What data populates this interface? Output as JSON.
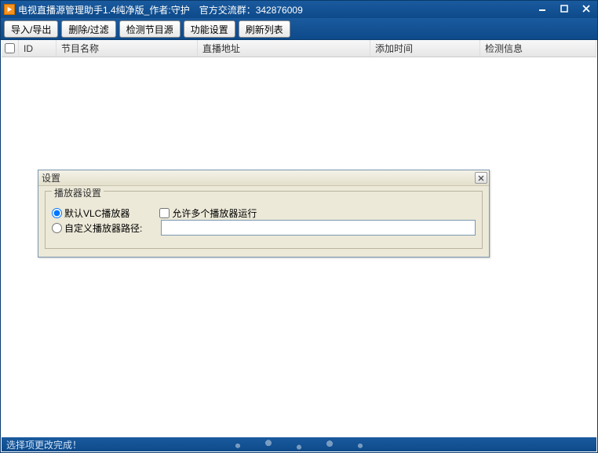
{
  "window": {
    "title": "电视直播源管理助手1.4纯净版_作者:守护　官方交流群：342876009"
  },
  "toolbar": {
    "import_export": "导入/导出",
    "delete_filter": "删除/过滤",
    "check_source": "检测节目源",
    "settings": "功能设置",
    "refresh": "刷新列表"
  },
  "columns": {
    "id": "ID",
    "name": "节目名称",
    "url": "直播地址",
    "time": "添加时间",
    "info": "检测信息"
  },
  "dialog": {
    "title": "设置",
    "group_title": "播放器设置",
    "default_vlc": "默认VLC播放器",
    "allow_multi": "允许多个播放器运行",
    "custom_path": "自定义播放器路径:",
    "path_value": ""
  },
  "statusbar": {
    "message": "选择项更改完成！"
  }
}
